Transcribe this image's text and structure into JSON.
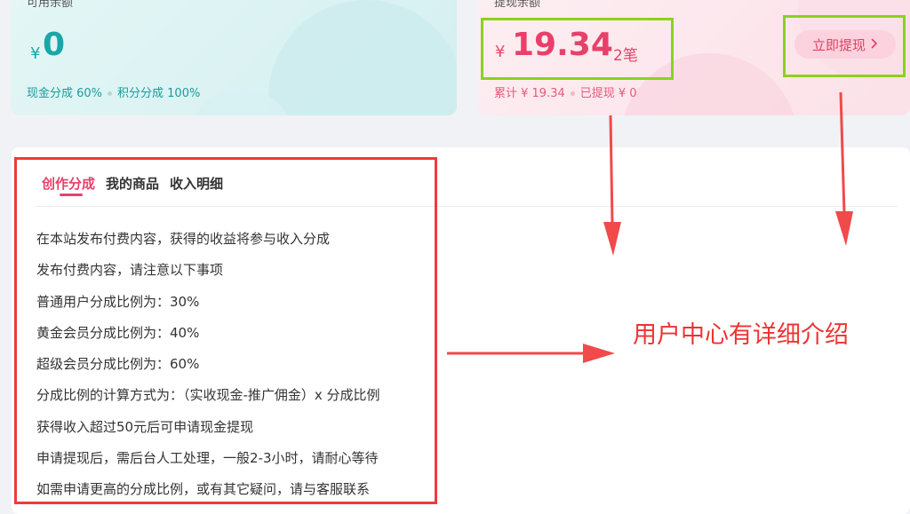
{
  "cash_card": {
    "title": "可用余额",
    "currency": "¥",
    "amount": "0",
    "split_cash": "现金分成 60%",
    "split_points": "积分分成 100%"
  },
  "withdraw_card": {
    "title": "提现余额",
    "currency": "¥",
    "amount": "19.34",
    "count": "2笔",
    "total": "累计 ¥ 19.34",
    "withdrawn": "已提现 ¥ 0",
    "button_label": "立即提现",
    "button_icon": "chevron-right-icon"
  },
  "tabs": [
    {
      "label": "创作分成",
      "active": true
    },
    {
      "label": "我的商品",
      "active": false
    },
    {
      "label": "收入明细",
      "active": false
    }
  ],
  "rules": [
    "在本站发布付费内容，获得的收益将参与收入分成",
    "发布付费内容，请注意以下事项",
    "普通用户分成比例为：30%",
    "黄金会员分成比例为：40%",
    "超级会员分成比例为：60%",
    "分成比例的计算方式为：（实收现金-推广佣金）x 分成比例",
    "获得收入超过50元后可申请现金提现",
    "申请提现后，需后台人工处理，一般2-3小时，请耐心等待",
    "如需申请更高的分成比例，或有其它疑问，请与客服联系"
  ],
  "annotation": "用户中心有详细介绍",
  "colors": {
    "teal": "#1aa6a6",
    "pink": "#e8406a",
    "highlight_green": "#8cd11c",
    "annotation_red": "#ec3b3b"
  }
}
